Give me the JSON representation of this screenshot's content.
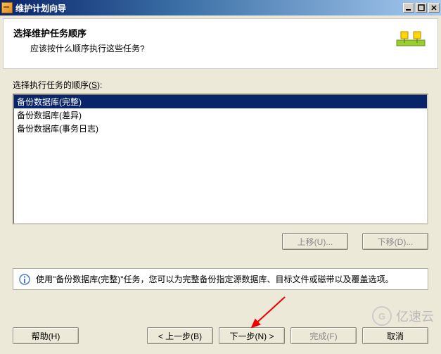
{
  "window": {
    "title": "维护计划向导"
  },
  "header": {
    "title": "选择维护任务顺序",
    "subtitle": "应该按什么顺序执行这些任务?"
  },
  "list": {
    "label_prefix": "选择执行任务的顺序(",
    "label_key": "S",
    "label_suffix": "):",
    "items": [
      {
        "text": "备份数据库(完整)",
        "selected": true
      },
      {
        "text": "备份数据库(差异)",
        "selected": false
      },
      {
        "text": "备份数据库(事务日志)",
        "selected": false
      }
    ]
  },
  "buttons": {
    "move_up": "上移(U)...",
    "move_down": "下移(D)...",
    "help": "帮助(H)",
    "back": "< 上一步(B)",
    "next": "下一步(N) >",
    "finish": "完成(F)",
    "cancel": "取消"
  },
  "info": {
    "text": "使用\"备份数据库(完整)\"任务，您可以为完整备份指定源数据库、目标文件或磁带以及覆盖选项。"
  },
  "watermark": {
    "text": "亿速云"
  }
}
